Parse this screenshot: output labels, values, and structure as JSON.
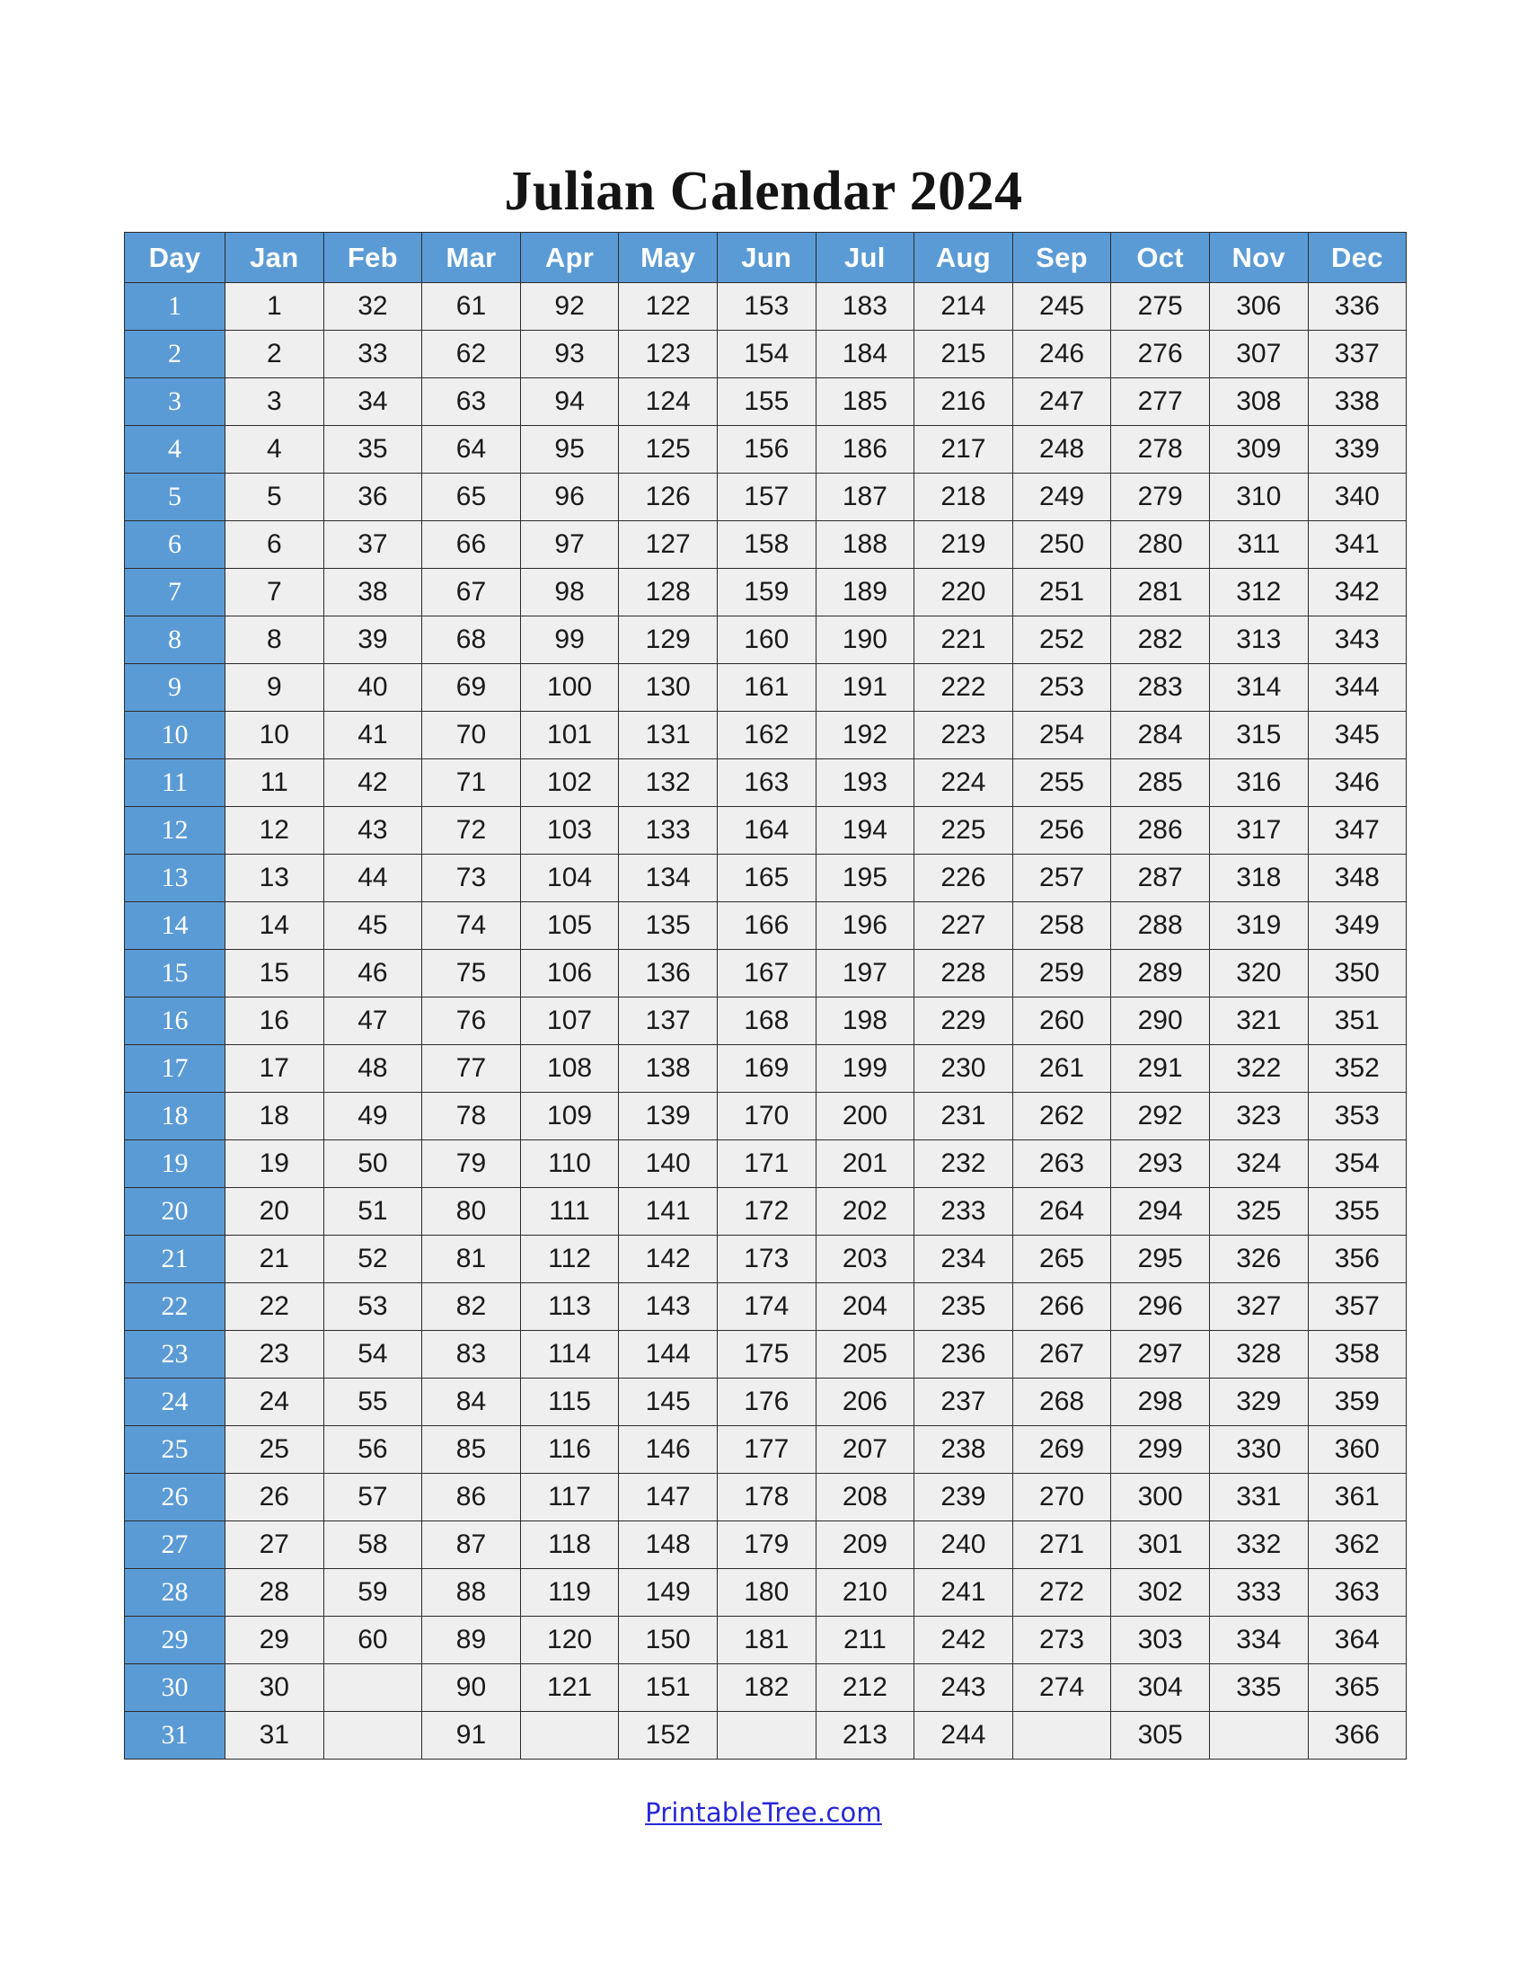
{
  "document": {
    "title": "Julian Calendar 2024"
  },
  "colors": {
    "header_blue": "#5B9BD5",
    "cell_gray": "#EFEFEF",
    "border": "#2b2b2b",
    "link_blue": "#2727d8",
    "text_dark": "#1a1a1a"
  },
  "table": {
    "columns": [
      "Day",
      "Jan",
      "Feb",
      "Mar",
      "Apr",
      "May",
      "Jun",
      "Jul",
      "Aug",
      "Sep",
      "Oct",
      "Nov",
      "Dec"
    ],
    "rows": [
      {
        "day": "1",
        "values": [
          "1",
          "32",
          "61",
          "92",
          "122",
          "153",
          "183",
          "214",
          "245",
          "275",
          "306",
          "336"
        ]
      },
      {
        "day": "2",
        "values": [
          "2",
          "33",
          "62",
          "93",
          "123",
          "154",
          "184",
          "215",
          "246",
          "276",
          "307",
          "337"
        ]
      },
      {
        "day": "3",
        "values": [
          "3",
          "34",
          "63",
          "94",
          "124",
          "155",
          "185",
          "216",
          "247",
          "277",
          "308",
          "338"
        ]
      },
      {
        "day": "4",
        "values": [
          "4",
          "35",
          "64",
          "95",
          "125",
          "156",
          "186",
          "217",
          "248",
          "278",
          "309",
          "339"
        ]
      },
      {
        "day": "5",
        "values": [
          "5",
          "36",
          "65",
          "96",
          "126",
          "157",
          "187",
          "218",
          "249",
          "279",
          "310",
          "340"
        ]
      },
      {
        "day": "6",
        "values": [
          "6",
          "37",
          "66",
          "97",
          "127",
          "158",
          "188",
          "219",
          "250",
          "280",
          "311",
          "341"
        ]
      },
      {
        "day": "7",
        "values": [
          "7",
          "38",
          "67",
          "98",
          "128",
          "159",
          "189",
          "220",
          "251",
          "281",
          "312",
          "342"
        ]
      },
      {
        "day": "8",
        "values": [
          "8",
          "39",
          "68",
          "99",
          "129",
          "160",
          "190",
          "221",
          "252",
          "282",
          "313",
          "343"
        ]
      },
      {
        "day": "9",
        "values": [
          "9",
          "40",
          "69",
          "100",
          "130",
          "161",
          "191",
          "222",
          "253",
          "283",
          "314",
          "344"
        ]
      },
      {
        "day": "10",
        "values": [
          "10",
          "41",
          "70",
          "101",
          "131",
          "162",
          "192",
          "223",
          "254",
          "284",
          "315",
          "345"
        ]
      },
      {
        "day": "11",
        "values": [
          "11",
          "42",
          "71",
          "102",
          "132",
          "163",
          "193",
          "224",
          "255",
          "285",
          "316",
          "346"
        ]
      },
      {
        "day": "12",
        "values": [
          "12",
          "43",
          "72",
          "103",
          "133",
          "164",
          "194",
          "225",
          "256",
          "286",
          "317",
          "347"
        ]
      },
      {
        "day": "13",
        "values": [
          "13",
          "44",
          "73",
          "104",
          "134",
          "165",
          "195",
          "226",
          "257",
          "287",
          "318",
          "348"
        ]
      },
      {
        "day": "14",
        "values": [
          "14",
          "45",
          "74",
          "105",
          "135",
          "166",
          "196",
          "227",
          "258",
          "288",
          "319",
          "349"
        ]
      },
      {
        "day": "15",
        "values": [
          "15",
          "46",
          "75",
          "106",
          "136",
          "167",
          "197",
          "228",
          "259",
          "289",
          "320",
          "350"
        ]
      },
      {
        "day": "16",
        "values": [
          "16",
          "47",
          "76",
          "107",
          "137",
          "168",
          "198",
          "229",
          "260",
          "290",
          "321",
          "351"
        ]
      },
      {
        "day": "17",
        "values": [
          "17",
          "48",
          "77",
          "108",
          "138",
          "169",
          "199",
          "230",
          "261",
          "291",
          "322",
          "352"
        ]
      },
      {
        "day": "18",
        "values": [
          "18",
          "49",
          "78",
          "109",
          "139",
          "170",
          "200",
          "231",
          "262",
          "292",
          "323",
          "353"
        ]
      },
      {
        "day": "19",
        "values": [
          "19",
          "50",
          "79",
          "110",
          "140",
          "171",
          "201",
          "232",
          "263",
          "293",
          "324",
          "354"
        ]
      },
      {
        "day": "20",
        "values": [
          "20",
          "51",
          "80",
          "111",
          "141",
          "172",
          "202",
          "233",
          "264",
          "294",
          "325",
          "355"
        ]
      },
      {
        "day": "21",
        "values": [
          "21",
          "52",
          "81",
          "112",
          "142",
          "173",
          "203",
          "234",
          "265",
          "295",
          "326",
          "356"
        ]
      },
      {
        "day": "22",
        "values": [
          "22",
          "53",
          "82",
          "113",
          "143",
          "174",
          "204",
          "235",
          "266",
          "296",
          "327",
          "357"
        ]
      },
      {
        "day": "23",
        "values": [
          "23",
          "54",
          "83",
          "114",
          "144",
          "175",
          "205",
          "236",
          "267",
          "297",
          "328",
          "358"
        ]
      },
      {
        "day": "24",
        "values": [
          "24",
          "55",
          "84",
          "115",
          "145",
          "176",
          "206",
          "237",
          "268",
          "298",
          "329",
          "359"
        ]
      },
      {
        "day": "25",
        "values": [
          "25",
          "56",
          "85",
          "116",
          "146",
          "177",
          "207",
          "238",
          "269",
          "299",
          "330",
          "360"
        ]
      },
      {
        "day": "26",
        "values": [
          "26",
          "57",
          "86",
          "117",
          "147",
          "178",
          "208",
          "239",
          "270",
          "300",
          "331",
          "361"
        ]
      },
      {
        "day": "27",
        "values": [
          "27",
          "58",
          "87",
          "118",
          "148",
          "179",
          "209",
          "240",
          "271",
          "301",
          "332",
          "362"
        ]
      },
      {
        "day": "28",
        "values": [
          "28",
          "59",
          "88",
          "119",
          "149",
          "180",
          "210",
          "241",
          "272",
          "302",
          "333",
          "363"
        ]
      },
      {
        "day": "29",
        "values": [
          "29",
          "60",
          "89",
          "120",
          "150",
          "181",
          "211",
          "242",
          "273",
          "303",
          "334",
          "364"
        ]
      },
      {
        "day": "30",
        "values": [
          "30",
          "",
          "90",
          "121",
          "151",
          "182",
          "212",
          "243",
          "274",
          "304",
          "335",
          "365"
        ]
      },
      {
        "day": "31",
        "values": [
          "31",
          "",
          "91",
          "",
          "152",
          "",
          "213",
          "244",
          "",
          "305",
          "",
          "366"
        ]
      }
    ]
  },
  "footer": {
    "link_text": "PrintableTree.com"
  }
}
